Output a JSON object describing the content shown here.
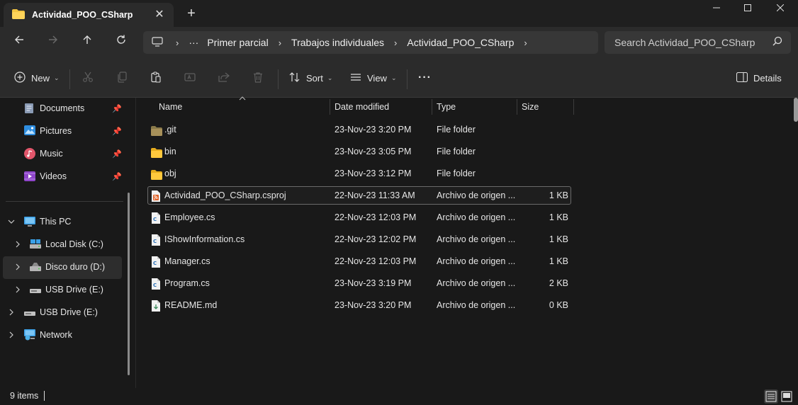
{
  "window": {
    "tab_title": "Actividad_POO_CSharp",
    "tab_close": "✕",
    "new_tab": "+"
  },
  "address": {
    "more": "···",
    "crumbs": [
      "Primer parcial",
      "Trabajos individuales",
      "Actividad_POO_CSharp"
    ]
  },
  "search": {
    "placeholder": "Search Actividad_POO_CSharp"
  },
  "commands": {
    "new": "New",
    "sort": "Sort",
    "view": "View",
    "more": "···",
    "details": "Details"
  },
  "sidebar": {
    "quick_access": [
      {
        "label": "Documents"
      },
      {
        "label": "Pictures"
      },
      {
        "label": "Music"
      },
      {
        "label": "Videos"
      }
    ],
    "this_pc": "This PC",
    "drives": [
      {
        "label": "Local Disk (C:)"
      },
      {
        "label": "Disco duro (D:)"
      },
      {
        "label": "USB Drive (E:)"
      }
    ],
    "usb_drive": "USB Drive (E:)",
    "network": "Network"
  },
  "columns": {
    "name": "Name",
    "date": "Date modified",
    "type": "Type",
    "size": "Size"
  },
  "files": [
    {
      "name": ".git",
      "date": "23-Nov-23 3:20 PM",
      "type": "File folder",
      "size": "",
      "icon": "folder-dark"
    },
    {
      "name": "bin",
      "date": "23-Nov-23 3:05 PM",
      "type": "File folder",
      "size": "",
      "icon": "folder"
    },
    {
      "name": "obj",
      "date": "23-Nov-23 3:12 PM",
      "type": "File folder",
      "size": "",
      "icon": "folder"
    },
    {
      "name": "Actividad_POO_CSharp.csproj",
      "date": "22-Nov-23 11:33 AM",
      "type": "Archivo de origen ...",
      "size": "1 KB",
      "icon": "rss"
    },
    {
      "name": "Employee.cs",
      "date": "22-Nov-23 12:03 PM",
      "type": "Archivo de origen ...",
      "size": "1 KB",
      "icon": "csharp"
    },
    {
      "name": "IShowInformation.cs",
      "date": "22-Nov-23 12:02 PM",
      "type": "Archivo de origen ...",
      "size": "1 KB",
      "icon": "csharp"
    },
    {
      "name": "Manager.cs",
      "date": "22-Nov-23 12:03 PM",
      "type": "Archivo de origen ...",
      "size": "1 KB",
      "icon": "csharp"
    },
    {
      "name": "Program.cs",
      "date": "23-Nov-23 3:19 PM",
      "type": "Archivo de origen ...",
      "size": "2 KB",
      "icon": "csharp"
    },
    {
      "name": "README.md",
      "date": "23-Nov-23 3:20 PM",
      "type": "Archivo de origen ...",
      "size": "0 KB",
      "icon": "markdown"
    }
  ],
  "status": {
    "items": "9 items"
  },
  "colors": {
    "accent": "#4cc2ff",
    "folder": "#f4c542",
    "background": "#191919"
  }
}
